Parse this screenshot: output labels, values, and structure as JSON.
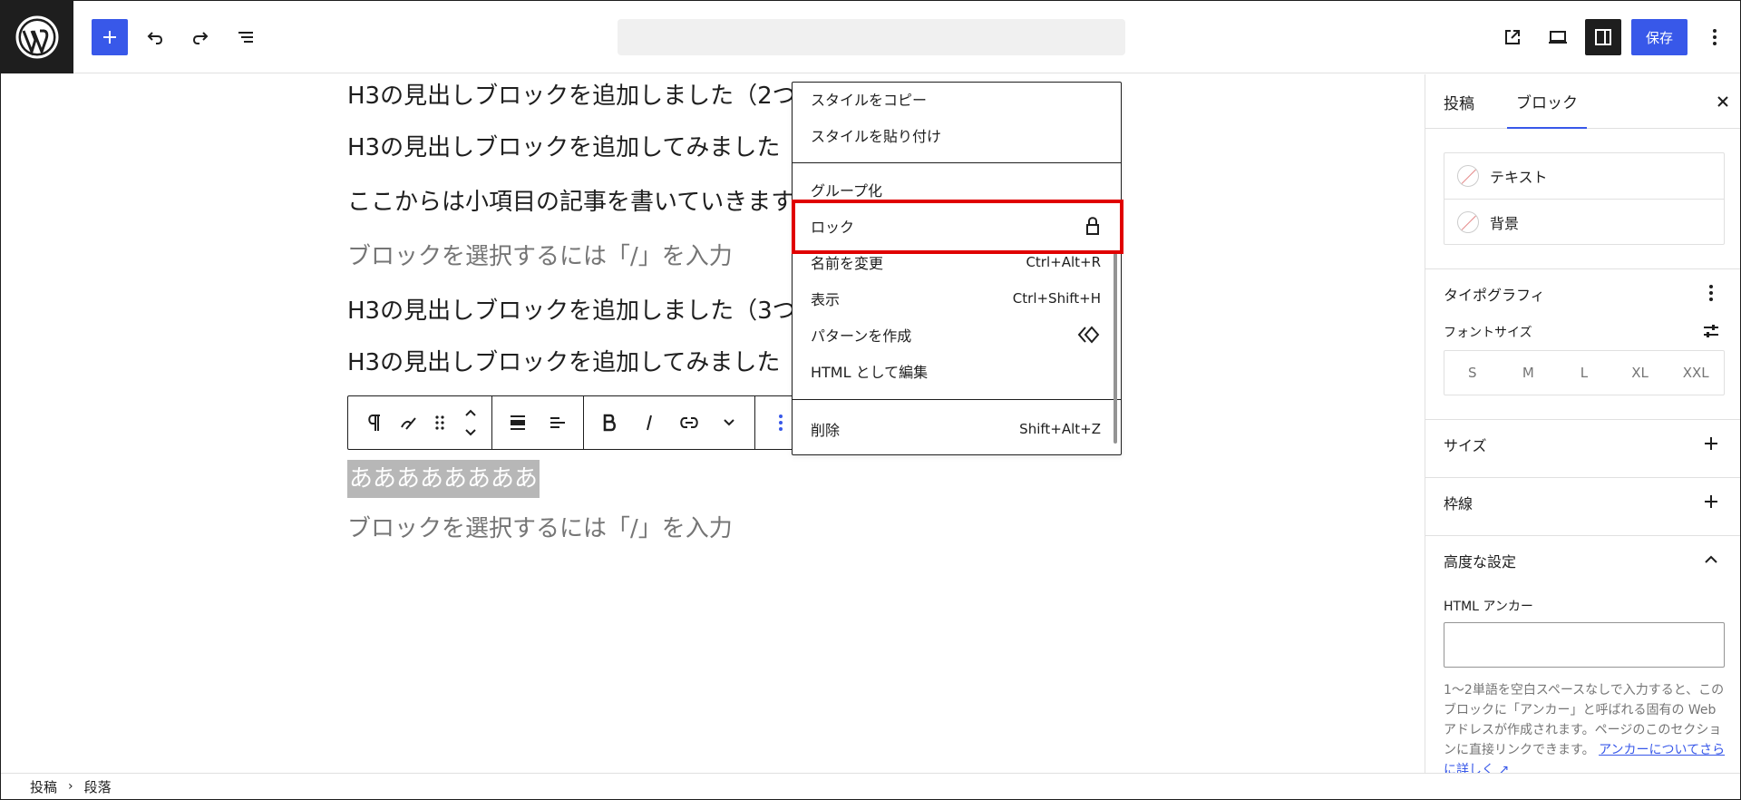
{
  "toolbar": {
    "save_label": "保存"
  },
  "canvas": {
    "lines": [
      "H3の見出しブロックを追加しました（2つ",
      "H3の見出しブロックを追加してみました",
      "ここからは小項目の記事を書いていきます",
      "ブロックを選択するには「/」を入力",
      "H3の見出しブロックを追加しました（3つ",
      "H3の見出しブロックを追加してみました"
    ],
    "selected_text": "ああああああああ",
    "placeholder_bottom": "ブロックを選択するには「/」を入力"
  },
  "context_menu": {
    "copy_styles": "スタイルをコピー",
    "paste_styles": "スタイルを貼り付け",
    "group": "グループ化",
    "lock": "ロック",
    "rename": "名前を変更",
    "rename_shortcut": "Ctrl+Alt+R",
    "show": "表示",
    "show_shortcut": "Ctrl+Shift+H",
    "create_pattern": "パターンを作成",
    "edit_html": "HTML として編集",
    "delete": "削除",
    "delete_shortcut": "Shift+Alt+Z"
  },
  "sidebar": {
    "tab_post": "投稿",
    "tab_block": "ブロック",
    "color_text": "テキスト",
    "color_background": "背景",
    "typography": "タイポグラフィ",
    "font_size": "フォントサイズ",
    "sizes": [
      "S",
      "M",
      "L",
      "XL",
      "XXL"
    ],
    "dimensions": "サイズ",
    "border": "枠線",
    "advanced": "高度な設定",
    "html_anchor": "HTML アンカー",
    "help_text": "1〜2単語を空白スペースなしで入力すると、このブロックに「アンカー」と呼ばれる固有の Web アドレスが作成されます。ページのこのセクションに直接リンクできます。",
    "help_link": "アンカーについてさらに詳しく ↗"
  },
  "footer": {
    "crumb_post": "投稿",
    "crumb_paragraph": "段落"
  },
  "colors": {
    "accent": "#3858e9",
    "highlight": "#e00000"
  }
}
